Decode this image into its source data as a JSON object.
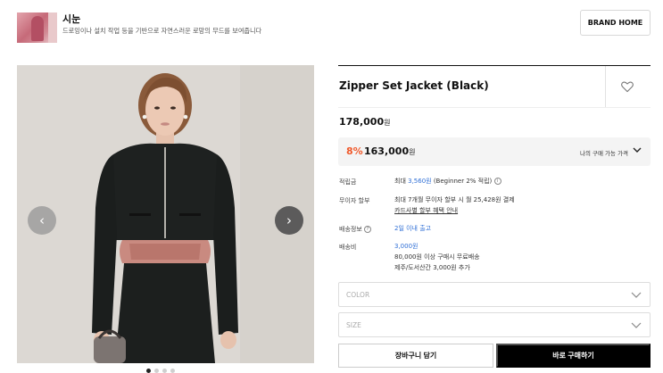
{
  "brand": {
    "name": "시눈",
    "description": "드로잉이나 설치 작업 등을 기반으로 자연스러운 로망의 무드를 보여줍니다",
    "home_button": "BRAND HOME"
  },
  "carousel": {
    "prev_icon": "chevron-left-icon",
    "next_icon": "chevron-right-icon",
    "prev_glyph": "‹",
    "next_glyph": "›",
    "total_dots": 4,
    "active_dot": 1
  },
  "product": {
    "title": "Zipper Set Jacket (Black)",
    "original_price": "178,000",
    "price_unit": "원",
    "discount_rate": "8%",
    "sale_price": "163,000",
    "my_price_label": "나의 구매 가능 가격",
    "wishlist_icon": "heart-icon"
  },
  "details": {
    "points_label": "적립금",
    "points_prefix": "최대 ",
    "points_amount": "3,560원",
    "points_suffix": " (Beginner 2% 적립)",
    "installment_label": "무이자 할부",
    "installment_text": "최대 7개월 무이자 할부 시 월 25,428원 결제",
    "installment_link": "카드사별 할부 혜택 안내",
    "shipping_info_label": "배송정보",
    "shipping_info_value": "2일 이내 출고",
    "shipping_fee_label": "배송비",
    "shipping_fee_value": "3,000원",
    "shipping_free_note": "80,000원 이상 구매시 무료배송",
    "shipping_island_note": "제주/도서산간 3,000원 추가"
  },
  "options": {
    "color_label": "COLOR",
    "size_label": "SIZE"
  },
  "actions": {
    "cart_label": "장바구니 담기",
    "buy_label": "바로 구매하기"
  },
  "colors": {
    "discount": "#f0592b",
    "link_blue": "#2f6fd6",
    "buy_button": "#000000"
  }
}
